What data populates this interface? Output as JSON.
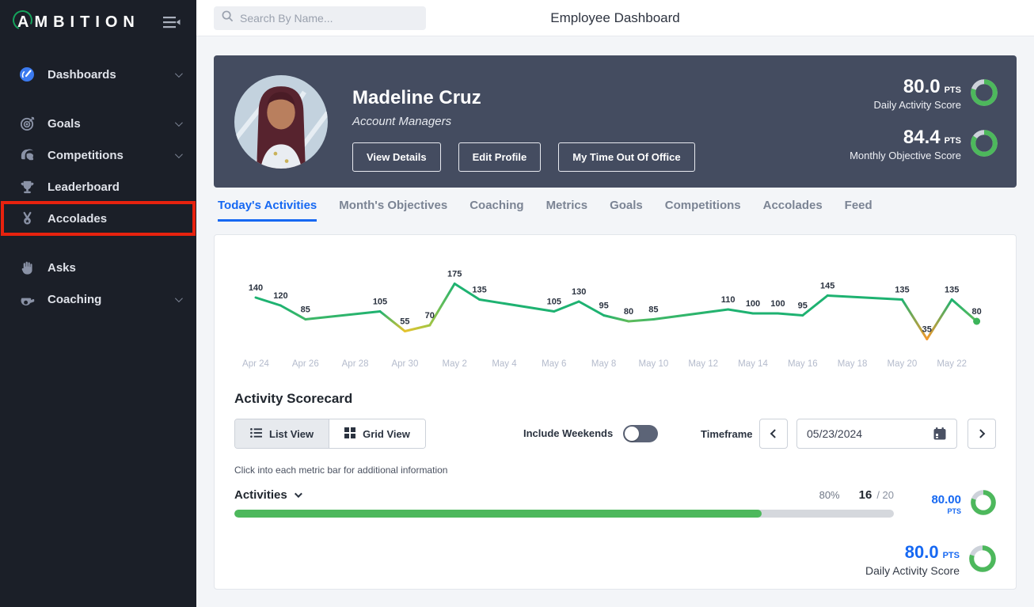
{
  "sidebar": {
    "logo": "AMBITION",
    "items": [
      {
        "label": "Dashboards",
        "icon": "gauge-icon",
        "chevron": true,
        "gap_before": false,
        "highlighted": false
      },
      {
        "label": "Goals",
        "icon": "target-icon",
        "chevron": true,
        "gap_before": true,
        "highlighted": false
      },
      {
        "label": "Competitions",
        "icon": "helmet-icon",
        "chevron": true,
        "gap_before": false,
        "highlighted": false
      },
      {
        "label": "Leaderboard",
        "icon": "trophy-icon",
        "chevron": false,
        "gap_before": false,
        "highlighted": false
      },
      {
        "label": "Accolades",
        "icon": "medal-icon",
        "chevron": false,
        "gap_before": false,
        "highlighted": true
      },
      {
        "label": "Asks",
        "icon": "hand-icon",
        "chevron": false,
        "gap_before": true,
        "highlighted": false
      },
      {
        "label": "Coaching",
        "icon": "whistle-icon",
        "chevron": true,
        "gap_before": false,
        "highlighted": false
      }
    ]
  },
  "topbar": {
    "search_placeholder": "Search By Name...",
    "title": "Employee Dashboard"
  },
  "profile": {
    "name": "Madeline Cruz",
    "role": "Account Managers",
    "buttons": [
      "View Details",
      "Edit Profile",
      "My Time Out Of Office"
    ],
    "scores": [
      {
        "value": "80.0",
        "unit": "PTS",
        "label": "Daily Activity Score",
        "percent": 80
      },
      {
        "value": "84.4",
        "unit": "PTS",
        "label": "Monthly Objective Score",
        "percent": 84.4
      }
    ]
  },
  "tabs": [
    "Today's Activities",
    "Month's Objectives",
    "Coaching",
    "Metrics",
    "Goals",
    "Competitions",
    "Accolades",
    "Feed"
  ],
  "active_tab": "Today's Activities",
  "chart_data": {
    "type": "line",
    "title": "Daily Activity Score trend",
    "x": [
      "Apr 24",
      "Apr 25",
      "Apr 26",
      "Apr 29",
      "Apr 30",
      "May 1",
      "May 2",
      "May 3",
      "May 6",
      "May 7",
      "May 8",
      "May 9",
      "May 10",
      "May 13",
      "May 14",
      "May 15",
      "May 16",
      "May 17",
      "May 20",
      "May 21",
      "May 22",
      "May 23"
    ],
    "day_index": [
      0,
      1,
      2,
      5,
      6,
      7,
      8,
      9,
      12,
      13,
      14,
      15,
      16,
      19,
      20,
      21,
      22,
      23,
      26,
      27,
      28,
      29
    ],
    "values": [
      140,
      120,
      85,
      105,
      55,
      70,
      175,
      135,
      105,
      130,
      95,
      80,
      85,
      110,
      100,
      100,
      95,
      145,
      135,
      35,
      135,
      80
    ],
    "x_tick_days": [
      0,
      2,
      4,
      6,
      8,
      10,
      12,
      14,
      16,
      18,
      20,
      22,
      24,
      26,
      28
    ],
    "x_tick_labels": [
      "Apr 24",
      "Apr 26",
      "Apr 28",
      "Apr 30",
      "May 2",
      "May 4",
      "May 6",
      "May 8",
      "May 10",
      "May 12",
      "May 14",
      "May 16",
      "May 18",
      "May 20",
      "May 22"
    ],
    "ylim": [
      0,
      200
    ],
    "grid": false,
    "legend": false,
    "weekends_excluded": true
  },
  "scorecard": {
    "heading": "Activity Scorecard",
    "views": {
      "list": "List View",
      "grid": "Grid View",
      "selected": "List View"
    },
    "include_weekends_label": "Include Weekends",
    "include_weekends_on": false,
    "timeframe": {
      "label": "Timeframe",
      "date": "05/23/2024"
    },
    "hint": "Click into each metric bar for additional information",
    "metric": {
      "name": "Activities",
      "percent_label": "80%",
      "completed": "16",
      "total_label": "/ 20",
      "points": "80.00",
      "points_unit": "PTS",
      "progress_pct": 80,
      "ring_percent": 80
    },
    "summary": {
      "value": "80.0",
      "unit": "PTS",
      "label": "Daily Activity Score",
      "percent": 80
    }
  },
  "colors": {
    "sidebar_bg": "#1b1f28",
    "accent_blue": "#1668f2",
    "profile_card": "#444c60",
    "ring_green": "#4db85c",
    "ring_track": "#cdd2da",
    "chart_green": "#1eb271",
    "chart_yellow": "#e4ce2d",
    "chart_orange": "#f2992c",
    "highlight_red": "#e8220e",
    "progress_track": "#d5d8dd"
  }
}
